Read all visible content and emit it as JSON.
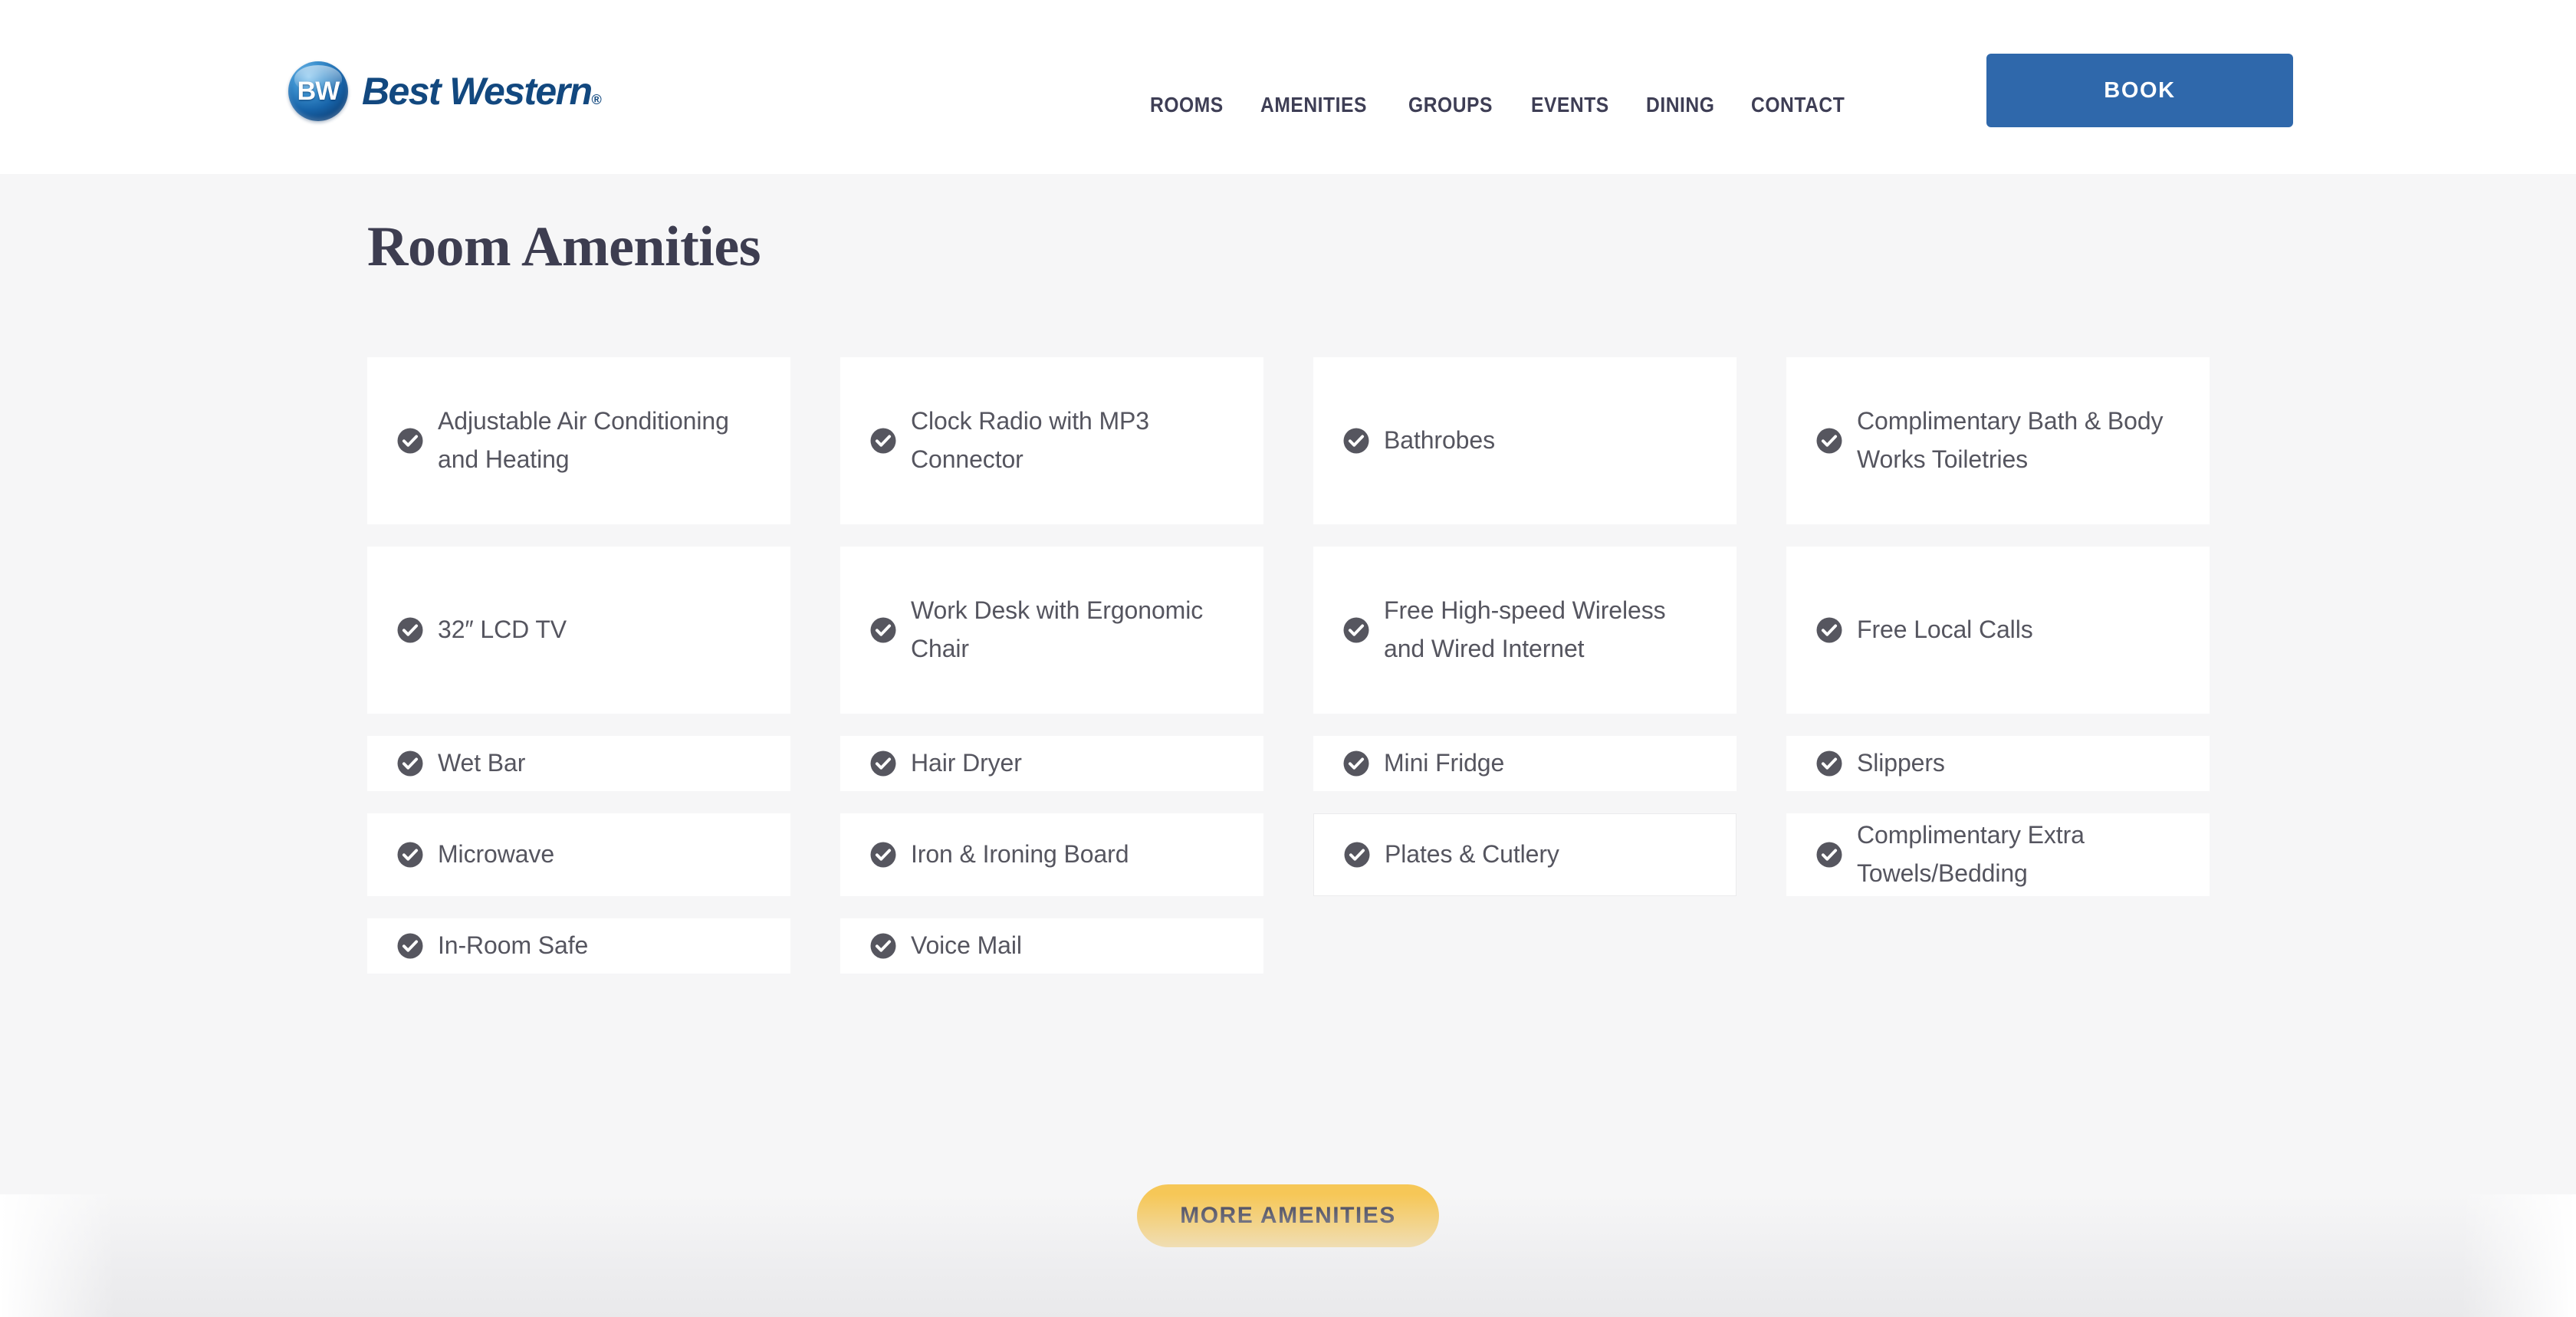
{
  "header": {
    "brand": {
      "badge_text": "BW",
      "wordmark": "Best Western",
      "registered_mark": "®"
    },
    "nav": [
      {
        "label": "ROOMS"
      },
      {
        "label": "AMENITIES"
      },
      {
        "label": "GROUPS"
      },
      {
        "label": "EVENTS"
      },
      {
        "label": "DINING"
      },
      {
        "label": "CONTACT"
      }
    ],
    "book_label": "BOOK",
    "book_color": "#2f68ab"
  },
  "main": {
    "title": "Room Amenities",
    "columns": [
      {
        "items": [
          {
            "label": "Adjustable Air Conditioning and Heating",
            "size": "tall"
          },
          {
            "label": "32″ LCD TV",
            "size": "tall"
          },
          {
            "label": "Wet Bar",
            "size": "short"
          },
          {
            "label": "Microwave",
            "size": "mid"
          },
          {
            "label": "In-Room Safe",
            "size": "short"
          }
        ]
      },
      {
        "items": [
          {
            "label": "Clock Radio with MP3 Connector",
            "size": "tall"
          },
          {
            "label": "Work Desk with Ergonomic Chair",
            "size": "tall"
          },
          {
            "label": "Hair Dryer",
            "size": "short"
          },
          {
            "label": "Iron & Ironing Board",
            "size": "mid"
          },
          {
            "label": "Voice Mail",
            "size": "short"
          }
        ]
      },
      {
        "items": [
          {
            "label": "Bathrobes",
            "size": "tall"
          },
          {
            "label": "Free High-speed Wireless and Wired Internet",
            "size": "tall"
          },
          {
            "label": "Mini Fridge",
            "size": "short"
          },
          {
            "label": "Plates & Cutlery",
            "size": "mid",
            "bordered": true
          }
        ]
      },
      {
        "items": [
          {
            "label": "Complimentary Bath & Body Works Toiletries",
            "size": "tall"
          },
          {
            "label": "Free Local Calls",
            "size": "tall"
          },
          {
            "label": "Slippers",
            "size": "short"
          },
          {
            "label": "Complimentary Extra Towels/Bedding",
            "size": "mid"
          }
        ]
      }
    ],
    "check_icon": "check-circle-icon",
    "check_icon_color": "#56565f",
    "card_background": "#ffffff",
    "section_background": "#f6f6f7"
  },
  "cta": {
    "more_label": "MORE AMENITIES",
    "more_color": "#f6c757"
  }
}
